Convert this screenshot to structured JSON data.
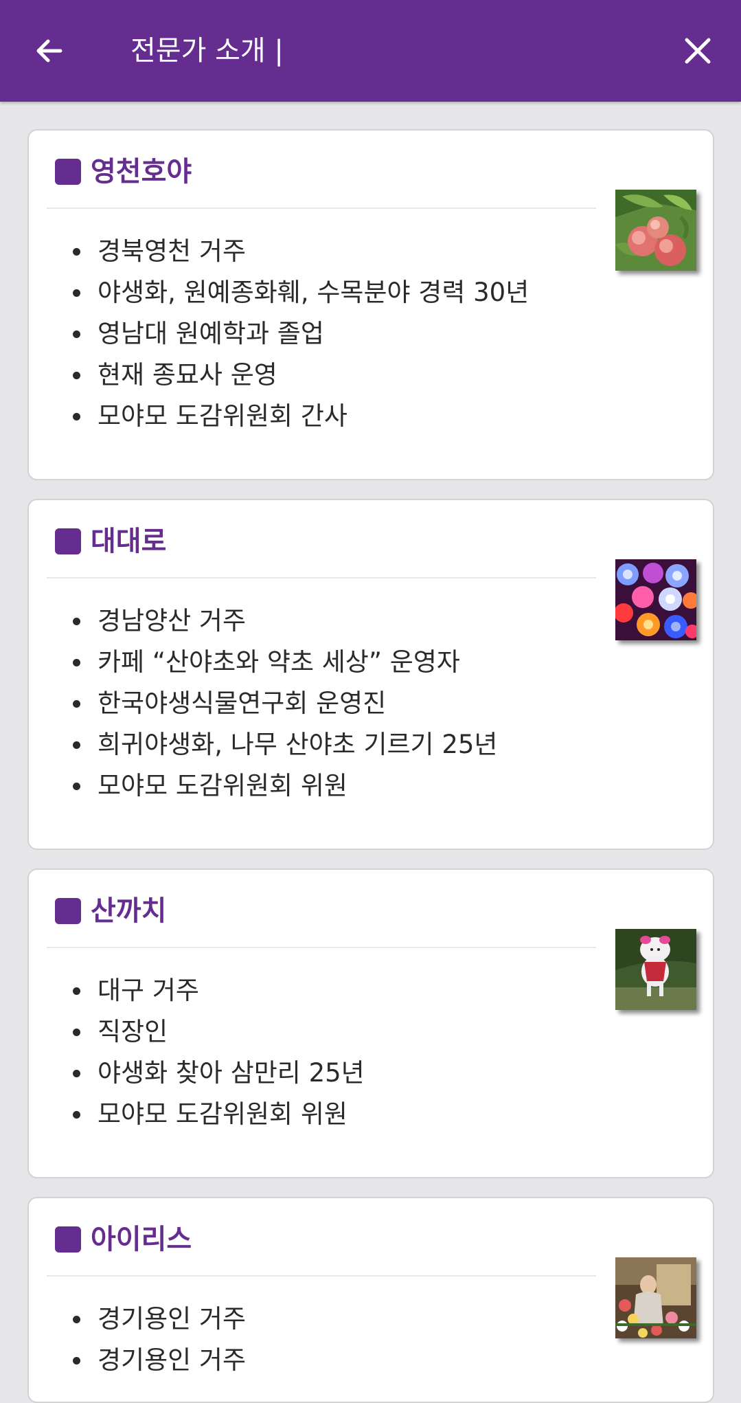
{
  "appbar": {
    "title": "전문가 소개 |",
    "back_icon": "arrow-left-icon",
    "close_icon": "close-icon"
  },
  "colors": {
    "primary": "#652d8f",
    "background": "#e6e6e9",
    "card": "#ffffff",
    "text": "#2a2a2a"
  },
  "experts": [
    {
      "name": "영천호야",
      "image": "peach-photo",
      "items": [
        "경북영천 거주",
        "야생화, 원예종화훼, 수목분야 경력 30년",
        "영남대 원예학과 졸업",
        "현재 종묘사 운영",
        "모야모 도감위원회 간사"
      ]
    },
    {
      "name": "대대로",
      "image": "glowing-roses-photo",
      "items": [
        "경남양산 거주",
        "카페 “산야초와 약초 세상” 운영자",
        "한국야생식물연구회 운영진",
        "희귀야생화, 나무 산야초 기르기 25년",
        "모야모 도감위원회 위원"
      ]
    },
    {
      "name": "산까치",
      "image": "white-dog-photo",
      "items": [
        "대구 거주",
        "직장인",
        "야생화 찾아 삼만리 25년",
        "모야모 도감위원회 위원"
      ]
    },
    {
      "name": "아이리스",
      "image": "painting-woman-flowers",
      "items": [
        "경기용인 거주",
        "경기용인 거주"
      ]
    }
  ]
}
